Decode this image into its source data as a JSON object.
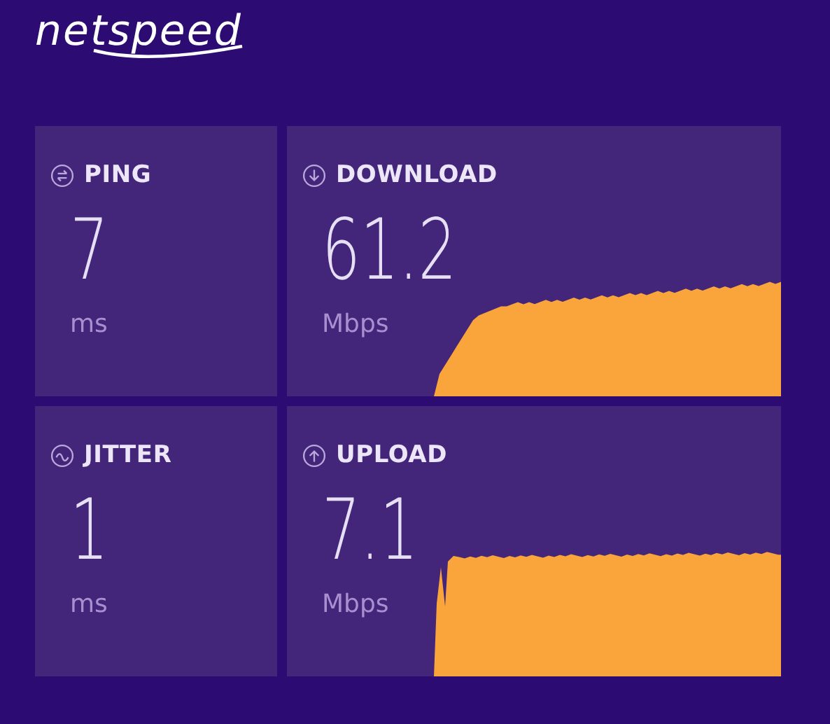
{
  "logo": "netspeed",
  "metrics": [
    {
      "kind": "ping",
      "label": "PING",
      "value": "7",
      "unit": "ms"
    },
    {
      "kind": "download",
      "label": "DOWNLOAD",
      "value": "61.2",
      "unit": "Mbps"
    },
    {
      "kind": "jitter",
      "label": "JITTER",
      "value": "1",
      "unit": "ms"
    },
    {
      "kind": "upload",
      "label": "UPLOAD",
      "value": "7.1",
      "unit": "Mbps"
    }
  ]
}
